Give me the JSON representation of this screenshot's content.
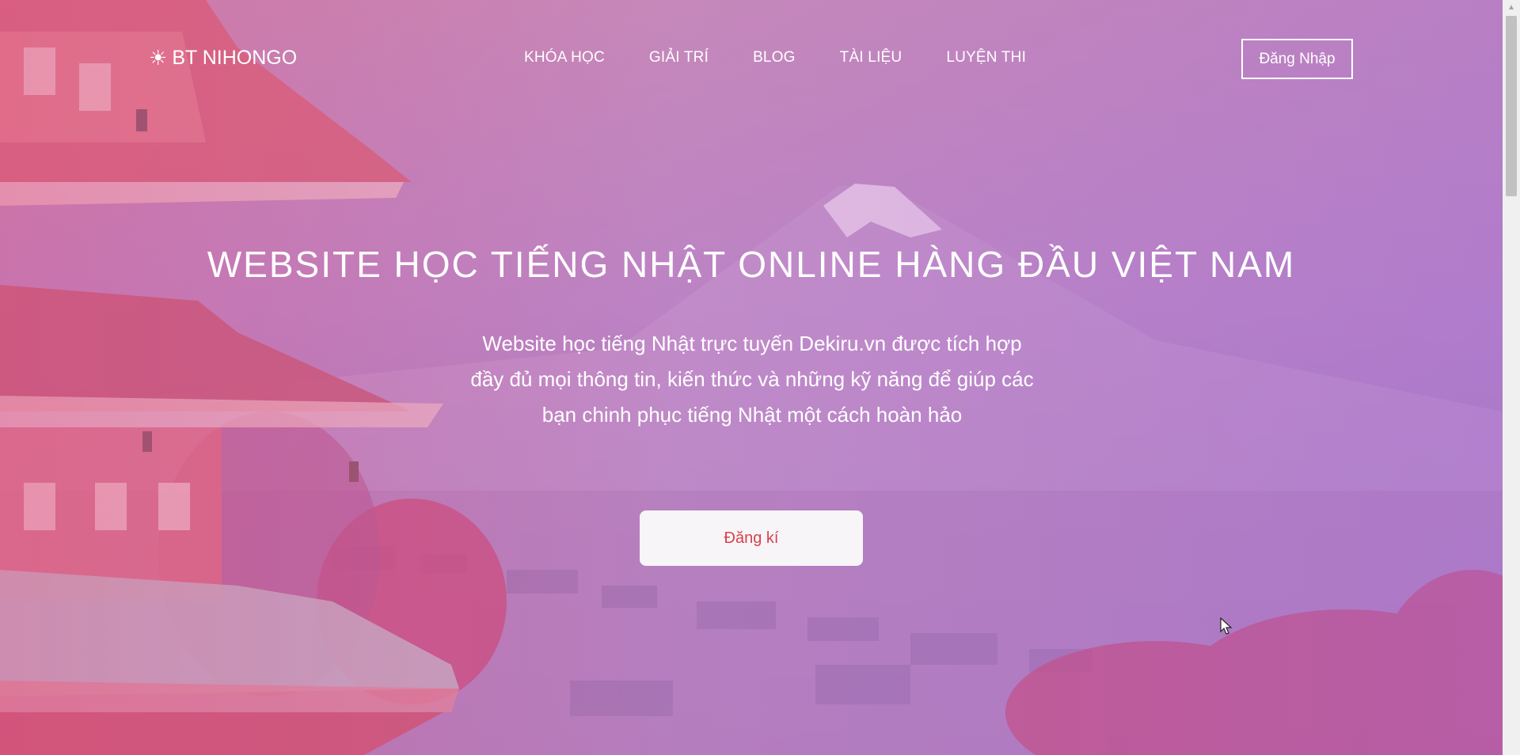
{
  "brand": {
    "icon": "sun-icon",
    "name": "BT NIHONGO"
  },
  "nav": {
    "items": [
      {
        "label": "KHÓA HỌC"
      },
      {
        "label": "GIẢI TRÍ"
      },
      {
        "label": "BLOG"
      },
      {
        "label": "TÀI LIỆU"
      },
      {
        "label": "LUYỆN THI"
      }
    ],
    "login_label": "Đăng Nhập"
  },
  "hero": {
    "headline": "WEBSITE HỌC TIẾNG NHẬT ONLINE HÀNG ĐẦU VIỆT NAM",
    "description_lines": [
      "Website học tiếng Nhật trực tuyến Dekiru.vn được tích hợp",
      "đầy đủ mọi thông tin, kiến thức và những kỹ năng để giúp các",
      "bạn chinh phục tiếng Nhật một cách hoàn hảo"
    ],
    "signup_label": "Đăng kí"
  },
  "colors": {
    "signup_text": "#d9414c",
    "overlay_pink": "#dd5a8c",
    "overlay_purple": "#a86ed2"
  }
}
